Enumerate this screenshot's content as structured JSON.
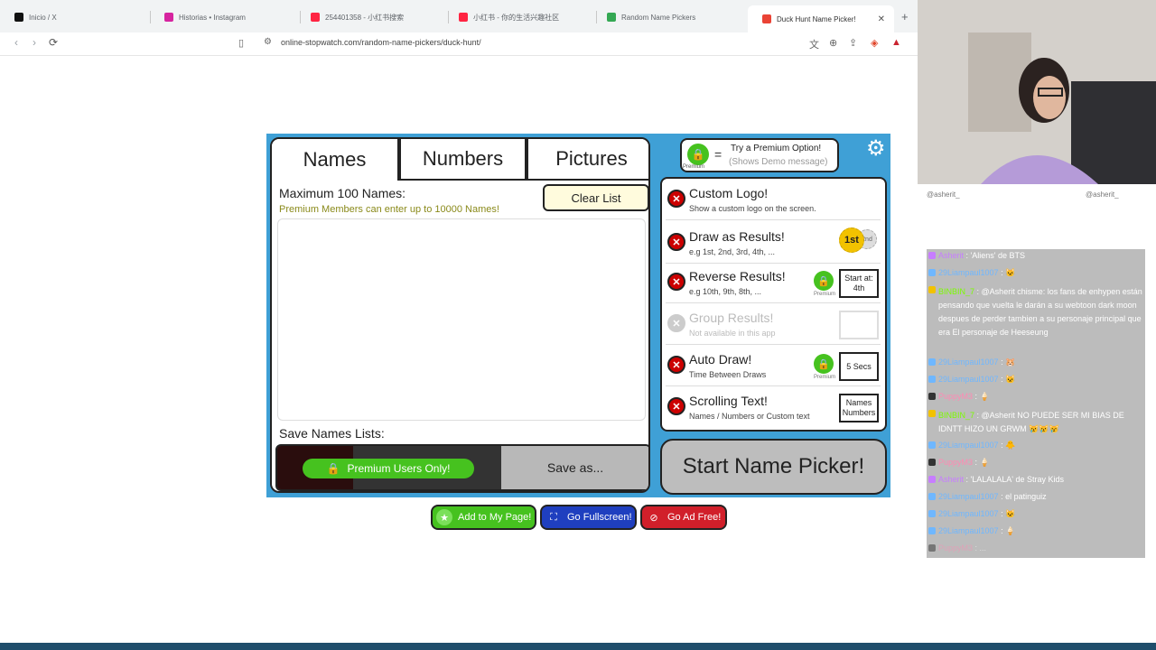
{
  "browser": {
    "tabs": [
      {
        "title": "Inicio / X",
        "color": "#111111"
      },
      {
        "title": "Historias • Instagram",
        "color": "#d6249f"
      },
      {
        "title": "254401358 - 小红书搜索",
        "color": "#ff2442"
      },
      {
        "title": "小红书 - 你的生活兴趣社区",
        "color": "#ff2442"
      },
      {
        "title": "Random Name Pickers",
        "color": "#34a853"
      },
      {
        "title": "Duck Hunt Name Picker!",
        "color": "#ea4335"
      }
    ],
    "url": "online-stopwatch.com/random-name-pickers/duck-hunt/"
  },
  "picker": {
    "tabs": [
      "Names",
      "Numbers",
      "Pictures"
    ],
    "max_names": "Maximum 100 Names:",
    "premium_note": "Premium Members can enter  up to 10000 Names!",
    "clear_list": "Clear List",
    "save_lists": "Save Names Lists:",
    "premium_only": "Premium Users Only!",
    "save_as": "Save as...",
    "premium_tip": {
      "title": "Try a Premium Option!",
      "sub": "(Shows Demo message)",
      "lock_label": "Premium",
      "eq": "="
    },
    "options": [
      {
        "title": "Custom Logo!",
        "sub": "Show a custom logo on the screen.",
        "box": "",
        "premium": false,
        "disabled": false
      },
      {
        "title": "Draw as Results!",
        "sub": "e.g 1st, 2nd, 3rd, 4th, ...",
        "box": "",
        "premium": false,
        "disabled": false,
        "medal": "1st",
        "medal2": "2nd"
      },
      {
        "title": "Reverse Results!",
        "sub": "e.g 10th, 9th, 8th, ...",
        "box": "Start at: 4th",
        "premium": true,
        "disabled": false
      },
      {
        "title": "Group Results!",
        "sub": "Not available in this app",
        "box": "",
        "premium": false,
        "disabled": true
      },
      {
        "title": "Auto Draw!",
        "sub": "Time Between Draws",
        "box": "5 Secs",
        "premium": true,
        "disabled": false
      },
      {
        "title": "Scrolling Text!",
        "sub": "Names / Numbers or Custom text",
        "box": "Names Numbers",
        "premium": false,
        "disabled": false
      }
    ],
    "premium_label": "Premium",
    "start": "Start Name Picker!"
  },
  "actions": [
    {
      "label": "Add to My Page!",
      "bg": "#46c21f",
      "icon": "★"
    },
    {
      "label": "Go Fullscreen!",
      "bg": "#1f3fbf",
      "icon": "⛶"
    },
    {
      "label": "Go Ad Free!",
      "bg": "#d11f2a",
      "icon": "⊘"
    }
  ],
  "stream": {
    "handle_left": "@asherit_",
    "handle_right": "@asherit_",
    "chat": [
      {
        "user": "Asherit",
        "msg": ": 'Aliens' de BTS",
        "color": "#c77dff"
      },
      {
        "user": "29Liampaul1007",
        "msg": ": 🐱",
        "color": "#6fb7ff"
      },
      {
        "user": "BINBIN_7",
        "msg": ": @Asherit chisme: los fans de enhypen están pensando que vuelta le darán a su webtoon dark moon despues de perder tambien a su personaje principal que era El personaje de Heeseung",
        "color": "#7cfc00"
      },
      {
        "user": "29Liampaul1007",
        "msg": ": 🐹",
        "color": "#6fb7ff"
      },
      {
        "user": "29Liampaul1007",
        "msg": ": 🐱",
        "color": "#6fb7ff"
      },
      {
        "user": "PuppyM3",
        "msg": ": 🍦",
        "color": "#ff8ab3"
      },
      {
        "user": "BINBIN_7",
        "msg": ": @Asherit NO PUEDE SER MI BIAS DE IDNTT HIZO UN GRWM 😿😿😿",
        "color": "#7cfc00"
      },
      {
        "user": "29Liampaul1007",
        "msg": ": 🐥",
        "color": "#6fb7ff"
      },
      {
        "user": "PuppyM3",
        "msg": ": 🍦",
        "color": "#ff8ab3"
      },
      {
        "user": "Asherit",
        "msg": ": 'LALALALA' de Stray Kids",
        "color": "#c77dff"
      },
      {
        "user": "29Liampaul1007",
        "msg": ": el patinguiz",
        "color": "#6fb7ff"
      },
      {
        "user": "29Liampaul1007",
        "msg": ": 🐱",
        "color": "#6fb7ff"
      },
      {
        "user": "29Liampaul1007",
        "msg": ": 🍦",
        "color": "#6fb7ff"
      },
      {
        "user": "PuppyM3",
        "msg": ": ...",
        "color": "#ff8ab3"
      }
    ]
  }
}
